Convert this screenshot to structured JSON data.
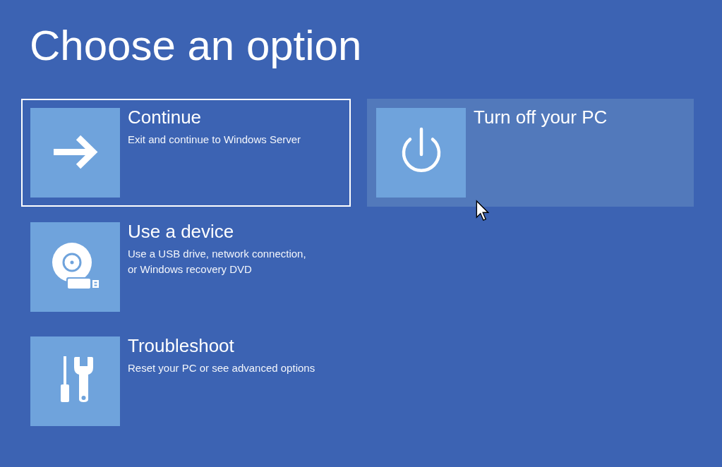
{
  "title": "Choose an option",
  "options": [
    {
      "kind": "arrow",
      "label": "Continue",
      "description": "Exit and continue to Windows Server",
      "selected": true,
      "hovered": false
    },
    {
      "kind": "device",
      "label": "Use a device",
      "description": "Use a USB drive, network connection,\nor Windows recovery DVD",
      "selected": false,
      "hovered": false
    },
    {
      "kind": "tools",
      "label": "Troubleshoot",
      "description": "Reset your PC or see advanced options",
      "selected": false,
      "hovered": false
    },
    {
      "kind": "power",
      "label": "Turn off your PC",
      "selected": false,
      "hovered": true
    }
  ]
}
